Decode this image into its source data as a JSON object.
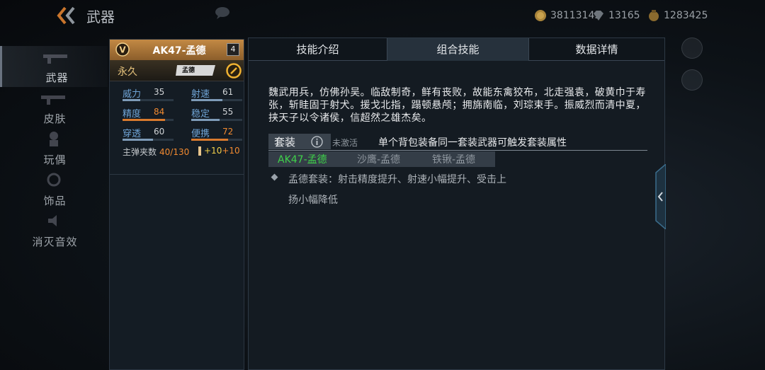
{
  "header": {
    "title": "武器",
    "currencies": [
      {
        "icon": "gold-coin-icon",
        "value": "38113145"
      },
      {
        "icon": "diamond-icon",
        "value": "13165"
      },
      {
        "icon": "medal-icon",
        "value": "1283425"
      }
    ]
  },
  "nav": {
    "items": [
      {
        "label": "武器",
        "active": true
      },
      {
        "label": "皮肤",
        "active": false
      },
      {
        "label": "玩偶",
        "active": false
      },
      {
        "label": "饰品",
        "active": false
      },
      {
        "label": "消灭音效",
        "active": false
      }
    ]
  },
  "weapon": {
    "name": "AK47-孟德",
    "level": "4",
    "duration": "永久",
    "tag_label": "孟德",
    "stats": [
      {
        "label": "威力",
        "value": "35",
        "level": 0.35,
        "highlight": false
      },
      {
        "label": "射速",
        "value": "61",
        "level": 0.61,
        "highlight": false
      },
      {
        "label": "精度",
        "value": "84",
        "level": 0.84,
        "highlight": true
      },
      {
        "label": "稳定",
        "value": "55",
        "level": 0.55,
        "highlight": false
      },
      {
        "label": "穿透",
        "value": "60",
        "level": 0.6,
        "highlight": false
      },
      {
        "label": "便携",
        "value": "72",
        "level": 0.72,
        "highlight": true
      }
    ],
    "ammo_label": "主弹夹数",
    "ammo_value": "40/130",
    "ammo_bonus_a": "+10",
    "ammo_bonus_b": "+10"
  },
  "tabs": [
    {
      "label": "技能介绍",
      "active": false
    },
    {
      "label": "组合技能",
      "active": true
    },
    {
      "label": "数据详情",
      "active": false
    }
  ],
  "description": "魏武用兵，仿佛孙吴。临敌制奇，鲜有丧败，故能东禽狡布，北走强袁，破黄巾于寿张，斩眭固于射犬。援戈北指，蹋顿悬颅；拥旆南临，刘琮束手。振威烈而清中夏，挟天子以令诸侯，信超然之雄杰矣。",
  "suit": {
    "label": "套装",
    "status": "未激活",
    "hint": "单个背包装备同一套装武器可触发套装属性",
    "members": [
      {
        "label": "AK47-孟德",
        "active": true
      },
      {
        "label": "沙鹰-孟德",
        "active": false
      },
      {
        "label": "铁锹-孟德",
        "active": false
      }
    ],
    "effect": "孟德套装：射击精度提升、射速小幅提升、受击上扬小幅降低"
  },
  "colors": {
    "accent_gold": "#c38944",
    "active_green": "#3fd24a",
    "stat_orange": "#f28a30",
    "stat_label_blue": "#6fa4d6"
  }
}
